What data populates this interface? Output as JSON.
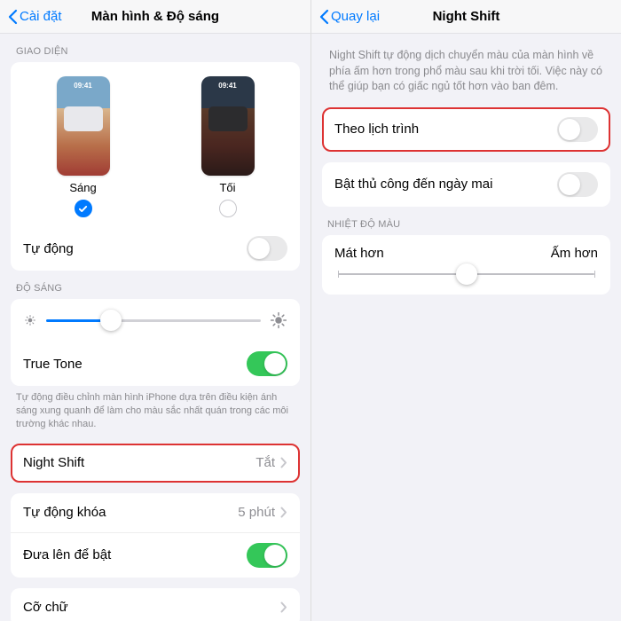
{
  "left": {
    "back": "Cài đặt",
    "title": "Màn hình & Độ sáng",
    "appearance_header": "GIAO DIỆN",
    "light_label": "Sáng",
    "dark_label": "Tối",
    "preview_time": "09:41",
    "selected_appearance": "light",
    "auto_label": "Tự động",
    "auto_on": false,
    "brightness_header": "ĐỘ SÁNG",
    "brightness_pct": 30,
    "truetone_label": "True Tone",
    "truetone_on": true,
    "truetone_desc": "Tự động điều chỉnh màn hình iPhone dựa trên điều kiện ánh sáng xung quanh để làm cho màu sắc nhất quán trong các môi trường khác nhau.",
    "nightshift_label": "Night Shift",
    "nightshift_value": "Tắt",
    "autolock_label": "Tự động khóa",
    "autolock_value": "5 phút",
    "raise_label": "Đưa lên để bật",
    "raise_on": true,
    "textsize_label": "Cỡ chữ"
  },
  "right": {
    "back": "Quay lại",
    "title": "Night Shift",
    "desc": "Night Shift tự động dịch chuyển màu của màn hình về phía ấm hơn trong phổ màu sau khi trời tối. Việc này có thể giúp bạn có giấc ngủ tốt hơn vào ban đêm.",
    "scheduled_label": "Theo lịch trình",
    "scheduled_on": false,
    "manual_label": "Bật thủ công đến ngày mai",
    "manual_on": false,
    "temp_header": "NHIỆT ĐỘ MÀU",
    "temp_cooler": "Mát hơn",
    "temp_warmer": "Ấm hơn",
    "temp_pct": 50
  }
}
